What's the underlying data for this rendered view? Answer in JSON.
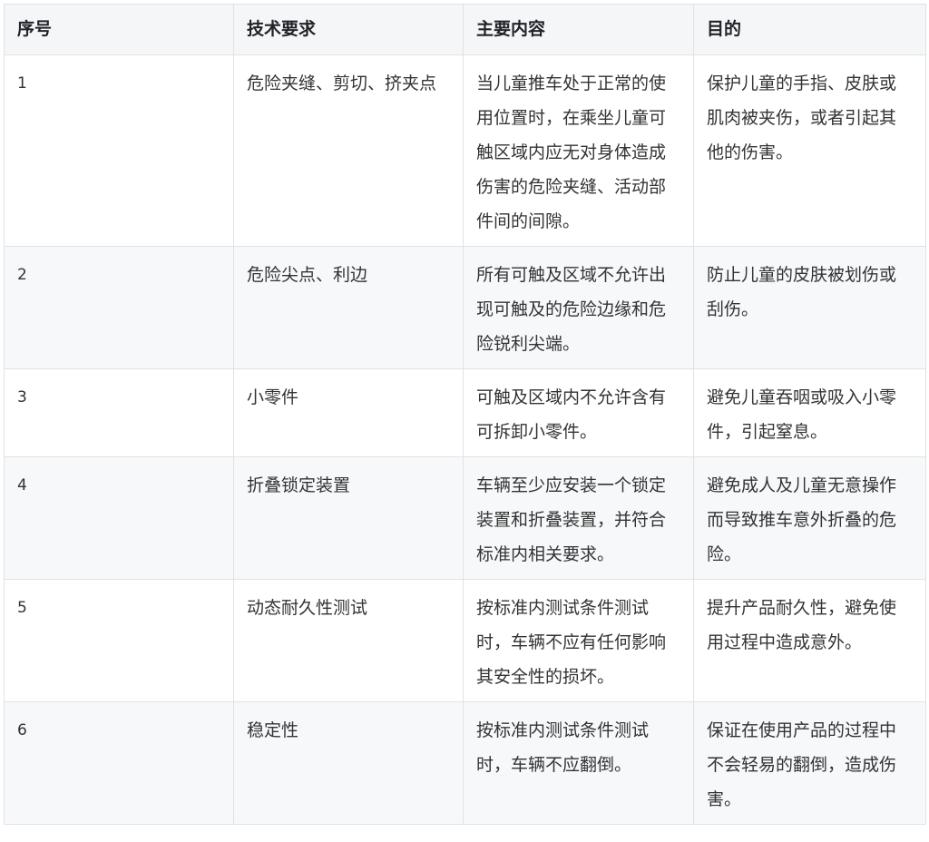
{
  "table": {
    "headers": [
      "序号",
      "技术要求",
      "主要内容",
      "目的"
    ],
    "rows": [
      {
        "no": "1",
        "requirement": "危险夹缝、剪切、挤夹点",
        "content": "当儿童推车处于正常的使用位置时，在乘坐儿童可触区域内应无对身体造成伤害的危险夹缝、活动部件间的间隙。",
        "purpose": "保护儿童的手指、皮肤或肌肉被夹伤，或者引起其他的伤害。"
      },
      {
        "no": "2",
        "requirement": "危险尖点、利边",
        "content": "所有可触及区域不允许出现可触及的危险边缘和危险锐利尖端。",
        "purpose": "防止儿童的皮肤被划伤或刮伤。"
      },
      {
        "no": "3",
        "requirement": "小零件",
        "content": "可触及区域内不允许含有可拆卸小零件。",
        "purpose": "避免儿童吞咽或吸入小零件，引起窒息。"
      },
      {
        "no": "4",
        "requirement": "折叠锁定装置",
        "content": "车辆至少应安装一个锁定装置和折叠装置，并符合标准内相关要求。",
        "purpose": "避免成人及儿童无意操作而导致推车意外折叠的危险。"
      },
      {
        "no": "5",
        "requirement": "动态耐久性测试",
        "content": "按标准内测试条件测试时，车辆不应有任何影响其安全性的损坏。",
        "purpose": "提升产品耐久性，避免使用过程中造成意外。"
      },
      {
        "no": "6",
        "requirement": "稳定性",
        "content": "按标准内测试条件测试时，车辆不应翻倒。",
        "purpose": "保证在使用产品的过程中不会轻易的翻倒，造成伤害。"
      }
    ]
  }
}
